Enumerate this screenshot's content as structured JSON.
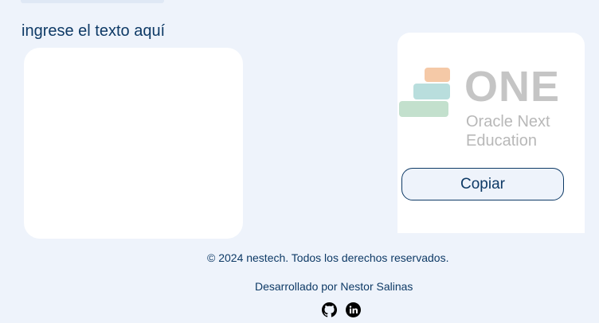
{
  "input": {
    "label": "ingrese el texto aquí",
    "value": "",
    "placeholder": ""
  },
  "output": {
    "logo_title": "ONE",
    "logo_line1": "Oracle Next",
    "logo_line2": "Education",
    "copy_button_label": "Copiar"
  },
  "footer": {
    "copyright": "© 2024 nestech. Todos los derechos reservados.",
    "developer": "Desarrollado por Nestor Salinas",
    "social_icons": [
      "github-icon",
      "linkedin-icon"
    ]
  },
  "colors": {
    "background": "#eef3fb",
    "text": "#0e3a66",
    "panel": "#ffffff",
    "logo_gray": "#c5c5c5"
  }
}
